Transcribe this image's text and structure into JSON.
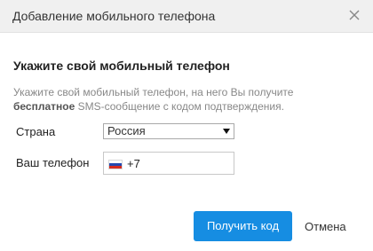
{
  "dialog": {
    "title": "Добавление мобильного телефона",
    "close_icon": "close-icon"
  },
  "content": {
    "heading": "Укажите свой мобильный телефон",
    "description_prefix": "Укажите свой мобильный телефон, на него Вы получите",
    "description_bold": "бесплатное",
    "description_suffix": " SMS-сообщение с кодом подтверждения."
  },
  "form": {
    "country_label": "Страна",
    "country_value": "Россия",
    "phone_label": "Ваш телефон",
    "phone_value": "+7",
    "flag_icon": "russia-flag-icon"
  },
  "actions": {
    "get_code_label": "Получить код",
    "cancel_label": "Отмена"
  },
  "colors": {
    "primary_button": "#168de2",
    "header_background": "#f0f0f0",
    "description_text": "#888888"
  }
}
